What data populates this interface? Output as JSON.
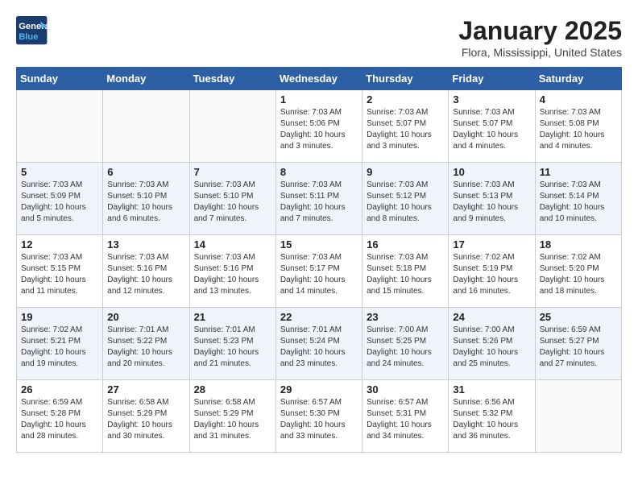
{
  "logo": {
    "line1": "General",
    "line2": "Blue"
  },
  "title": "January 2025",
  "location": "Flora, Mississippi, United States",
  "weekdays": [
    "Sunday",
    "Monday",
    "Tuesday",
    "Wednesday",
    "Thursday",
    "Friday",
    "Saturday"
  ],
  "weeks": [
    [
      {
        "day": "",
        "sunrise": "",
        "sunset": "",
        "daylight": ""
      },
      {
        "day": "",
        "sunrise": "",
        "sunset": "",
        "daylight": ""
      },
      {
        "day": "",
        "sunrise": "",
        "sunset": "",
        "daylight": ""
      },
      {
        "day": "1",
        "sunrise": "Sunrise: 7:03 AM",
        "sunset": "Sunset: 5:06 PM",
        "daylight": "Daylight: 10 hours and 3 minutes."
      },
      {
        "day": "2",
        "sunrise": "Sunrise: 7:03 AM",
        "sunset": "Sunset: 5:07 PM",
        "daylight": "Daylight: 10 hours and 3 minutes."
      },
      {
        "day": "3",
        "sunrise": "Sunrise: 7:03 AM",
        "sunset": "Sunset: 5:07 PM",
        "daylight": "Daylight: 10 hours and 4 minutes."
      },
      {
        "day": "4",
        "sunrise": "Sunrise: 7:03 AM",
        "sunset": "Sunset: 5:08 PM",
        "daylight": "Daylight: 10 hours and 4 minutes."
      }
    ],
    [
      {
        "day": "5",
        "sunrise": "Sunrise: 7:03 AM",
        "sunset": "Sunset: 5:09 PM",
        "daylight": "Daylight: 10 hours and 5 minutes."
      },
      {
        "day": "6",
        "sunrise": "Sunrise: 7:03 AM",
        "sunset": "Sunset: 5:10 PM",
        "daylight": "Daylight: 10 hours and 6 minutes."
      },
      {
        "day": "7",
        "sunrise": "Sunrise: 7:03 AM",
        "sunset": "Sunset: 5:10 PM",
        "daylight": "Daylight: 10 hours and 7 minutes."
      },
      {
        "day": "8",
        "sunrise": "Sunrise: 7:03 AM",
        "sunset": "Sunset: 5:11 PM",
        "daylight": "Daylight: 10 hours and 7 minutes."
      },
      {
        "day": "9",
        "sunrise": "Sunrise: 7:03 AM",
        "sunset": "Sunset: 5:12 PM",
        "daylight": "Daylight: 10 hours and 8 minutes."
      },
      {
        "day": "10",
        "sunrise": "Sunrise: 7:03 AM",
        "sunset": "Sunset: 5:13 PM",
        "daylight": "Daylight: 10 hours and 9 minutes."
      },
      {
        "day": "11",
        "sunrise": "Sunrise: 7:03 AM",
        "sunset": "Sunset: 5:14 PM",
        "daylight": "Daylight: 10 hours and 10 minutes."
      }
    ],
    [
      {
        "day": "12",
        "sunrise": "Sunrise: 7:03 AM",
        "sunset": "Sunset: 5:15 PM",
        "daylight": "Daylight: 10 hours and 11 minutes."
      },
      {
        "day": "13",
        "sunrise": "Sunrise: 7:03 AM",
        "sunset": "Sunset: 5:16 PM",
        "daylight": "Daylight: 10 hours and 12 minutes."
      },
      {
        "day": "14",
        "sunrise": "Sunrise: 7:03 AM",
        "sunset": "Sunset: 5:16 PM",
        "daylight": "Daylight: 10 hours and 13 minutes."
      },
      {
        "day": "15",
        "sunrise": "Sunrise: 7:03 AM",
        "sunset": "Sunset: 5:17 PM",
        "daylight": "Daylight: 10 hours and 14 minutes."
      },
      {
        "day": "16",
        "sunrise": "Sunrise: 7:03 AM",
        "sunset": "Sunset: 5:18 PM",
        "daylight": "Daylight: 10 hours and 15 minutes."
      },
      {
        "day": "17",
        "sunrise": "Sunrise: 7:02 AM",
        "sunset": "Sunset: 5:19 PM",
        "daylight": "Daylight: 10 hours and 16 minutes."
      },
      {
        "day": "18",
        "sunrise": "Sunrise: 7:02 AM",
        "sunset": "Sunset: 5:20 PM",
        "daylight": "Daylight: 10 hours and 18 minutes."
      }
    ],
    [
      {
        "day": "19",
        "sunrise": "Sunrise: 7:02 AM",
        "sunset": "Sunset: 5:21 PM",
        "daylight": "Daylight: 10 hours and 19 minutes."
      },
      {
        "day": "20",
        "sunrise": "Sunrise: 7:01 AM",
        "sunset": "Sunset: 5:22 PM",
        "daylight": "Daylight: 10 hours and 20 minutes."
      },
      {
        "day": "21",
        "sunrise": "Sunrise: 7:01 AM",
        "sunset": "Sunset: 5:23 PM",
        "daylight": "Daylight: 10 hours and 21 minutes."
      },
      {
        "day": "22",
        "sunrise": "Sunrise: 7:01 AM",
        "sunset": "Sunset: 5:24 PM",
        "daylight": "Daylight: 10 hours and 23 minutes."
      },
      {
        "day": "23",
        "sunrise": "Sunrise: 7:00 AM",
        "sunset": "Sunset: 5:25 PM",
        "daylight": "Daylight: 10 hours and 24 minutes."
      },
      {
        "day": "24",
        "sunrise": "Sunrise: 7:00 AM",
        "sunset": "Sunset: 5:26 PM",
        "daylight": "Daylight: 10 hours and 25 minutes."
      },
      {
        "day": "25",
        "sunrise": "Sunrise: 6:59 AM",
        "sunset": "Sunset: 5:27 PM",
        "daylight": "Daylight: 10 hours and 27 minutes."
      }
    ],
    [
      {
        "day": "26",
        "sunrise": "Sunrise: 6:59 AM",
        "sunset": "Sunset: 5:28 PM",
        "daylight": "Daylight: 10 hours and 28 minutes."
      },
      {
        "day": "27",
        "sunrise": "Sunrise: 6:58 AM",
        "sunset": "Sunset: 5:29 PM",
        "daylight": "Daylight: 10 hours and 30 minutes."
      },
      {
        "day": "28",
        "sunrise": "Sunrise: 6:58 AM",
        "sunset": "Sunset: 5:29 PM",
        "daylight": "Daylight: 10 hours and 31 minutes."
      },
      {
        "day": "29",
        "sunrise": "Sunrise: 6:57 AM",
        "sunset": "Sunset: 5:30 PM",
        "daylight": "Daylight: 10 hours and 33 minutes."
      },
      {
        "day": "30",
        "sunrise": "Sunrise: 6:57 AM",
        "sunset": "Sunset: 5:31 PM",
        "daylight": "Daylight: 10 hours and 34 minutes."
      },
      {
        "day": "31",
        "sunrise": "Sunrise: 6:56 AM",
        "sunset": "Sunset: 5:32 PM",
        "daylight": "Daylight: 10 hours and 36 minutes."
      },
      {
        "day": "",
        "sunrise": "",
        "sunset": "",
        "daylight": ""
      }
    ]
  ]
}
